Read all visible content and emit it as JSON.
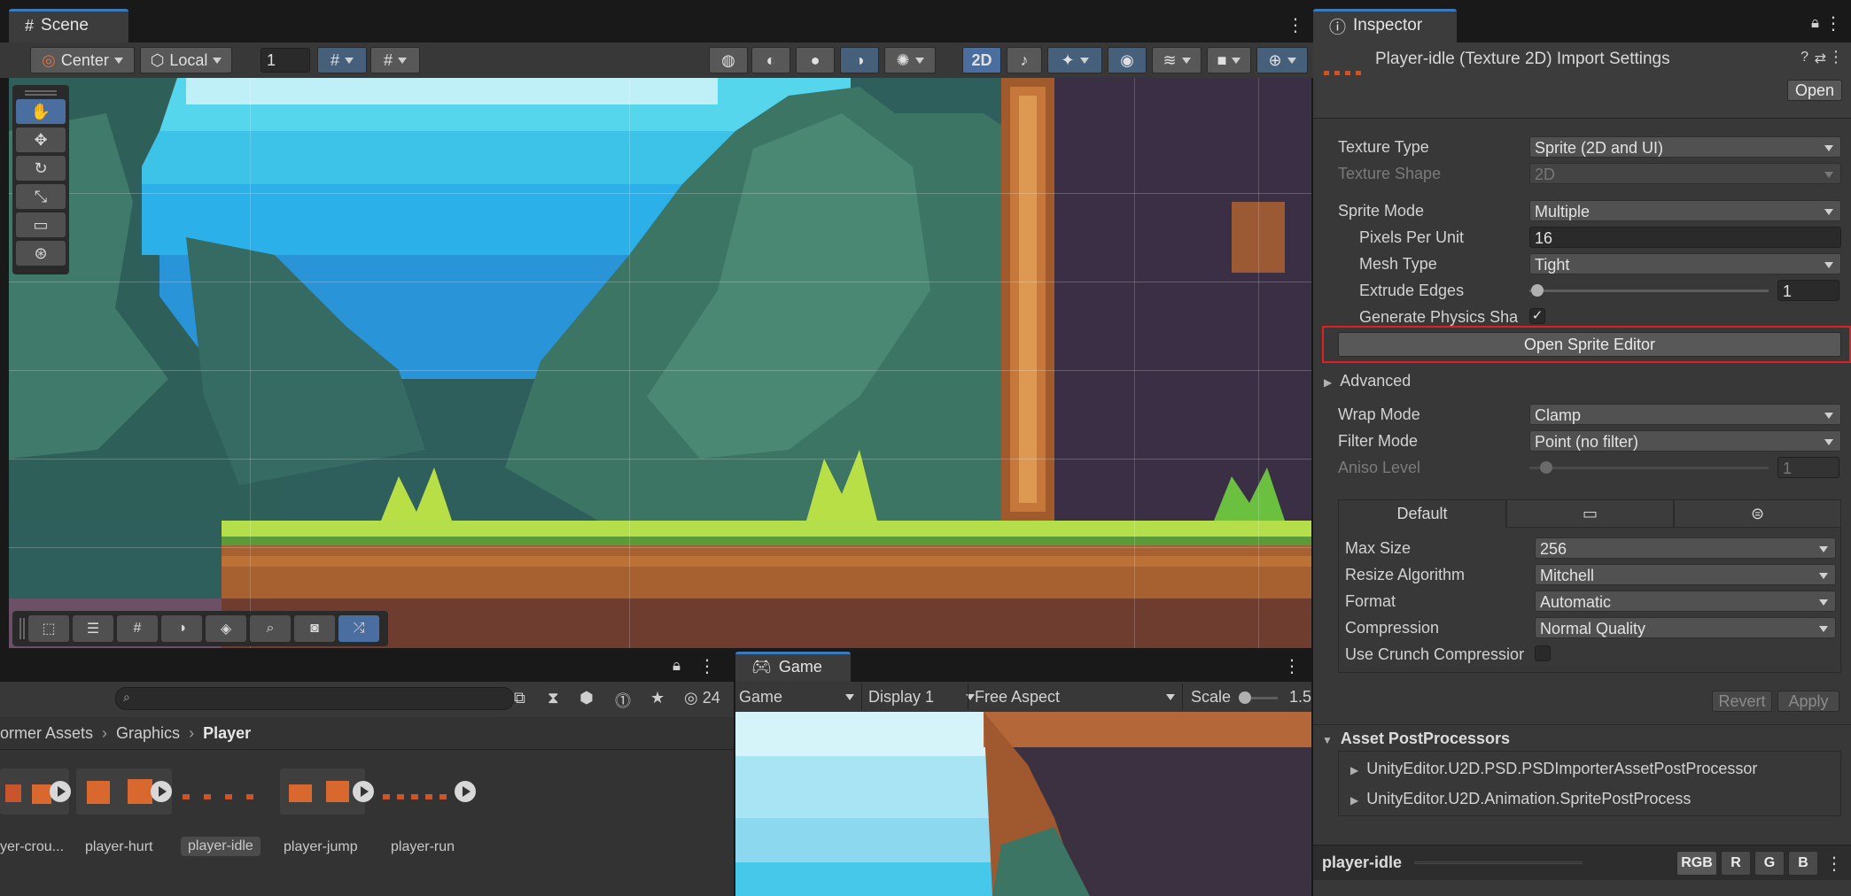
{
  "scene": {
    "tab_label": "Scene",
    "pivot_mode": "Center",
    "pivot_rotation": "Local",
    "grid_step": "1",
    "mode_2d": "2D"
  },
  "game": {
    "tab_label": "Game",
    "view_dropdown": "Game",
    "display_dropdown": "Display 1",
    "aspect_dropdown": "Free Aspect",
    "scale_label": "Scale",
    "scale_value": "1.5"
  },
  "project": {
    "hidden_count": "24",
    "breadcrumb": [
      "ormer Assets",
      "Graphics",
      "Player"
    ],
    "assets": [
      {
        "label": "yer-crou..."
      },
      {
        "label": "player-hurt"
      },
      {
        "label": "player-idle",
        "selected": true
      },
      {
        "label": "player-jump"
      },
      {
        "label": "player-run"
      }
    ]
  },
  "inspector": {
    "tab_label": "Inspector",
    "title": "Player-idle (Texture 2D) Import Settings",
    "open_button": "Open",
    "fields": {
      "texture_type_label": "Texture Type",
      "texture_type_value": "Sprite (2D and UI)",
      "texture_shape_label": "Texture Shape",
      "texture_shape_value": "2D",
      "sprite_mode_label": "Sprite Mode",
      "sprite_mode_value": "Multiple",
      "ppu_label": "Pixels Per Unit",
      "ppu_value": "16",
      "mesh_type_label": "Mesh Type",
      "mesh_type_value": "Tight",
      "extrude_label": "Extrude Edges",
      "extrude_value": "1",
      "physics_label": "Generate Physics Sha",
      "physics_checked": true,
      "sprite_editor_button": "Open Sprite Editor",
      "advanced_label": "Advanced",
      "wrap_label": "Wrap Mode",
      "wrap_value": "Clamp",
      "filter_label": "Filter Mode",
      "filter_value": "Point (no filter)",
      "aniso_label": "Aniso Level",
      "aniso_value": "1"
    },
    "platform": {
      "default_tab": "Default",
      "max_size_label": "Max Size",
      "max_size_value": "256",
      "resize_label": "Resize Algorithm",
      "resize_value": "Mitchell",
      "format_label": "Format",
      "format_value": "Automatic",
      "compression_label": "Compression",
      "compression_value": "Normal Quality",
      "crunch_label": "Use Crunch Compressior",
      "crunch_checked": false
    },
    "revert_button": "Revert",
    "apply_button": "Apply",
    "postprocessors": {
      "header": "Asset PostProcessors",
      "items": [
        "UnityEditor.U2D.PSD.PSDImporterAssetPostProcessor",
        "UnityEditor.U2D.Animation.SpritePostProcess"
      ]
    },
    "preview": {
      "name": "player-idle",
      "channels": [
        "RGB",
        "R",
        "G",
        "B"
      ]
    }
  },
  "colors": {
    "accent": "#3a79bb",
    "highlight_box": "#e02020",
    "selected_asset_bg": "#4b4b4b"
  }
}
